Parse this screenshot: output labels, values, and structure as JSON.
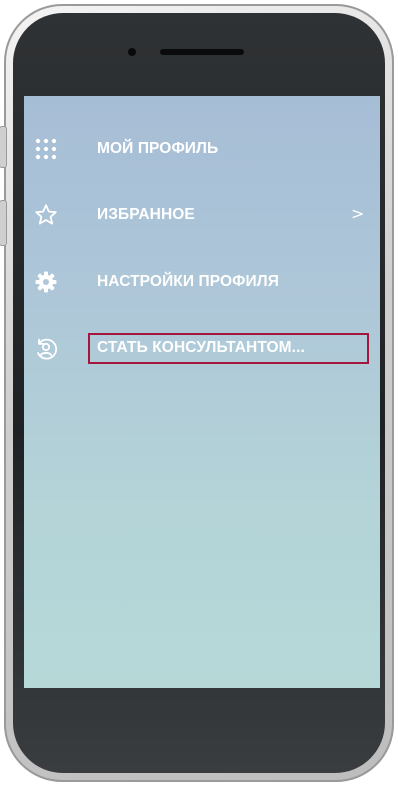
{
  "menu": {
    "items": [
      {
        "label": "МОЙ ПРОФИЛЬ",
        "icon": "grid-dots-icon"
      },
      {
        "label": "ИЗБРАННОЕ",
        "icon": "star-outline-icon",
        "has_chevron": true
      },
      {
        "label": "НАСТРОЙКИ ПРОФИЛЯ",
        "icon": "gear-icon"
      },
      {
        "label": "СТАТЬ КОНСУЛЬТАНТОМ...",
        "icon": "user-circle-icon",
        "highlighted": true
      }
    ],
    "chevron_glyph": ">"
  },
  "colors": {
    "screen_top": "#a6bdd6",
    "screen_bottom": "#b6d9d8",
    "text": "#ffffff",
    "highlight_border": "#a3173e"
  }
}
